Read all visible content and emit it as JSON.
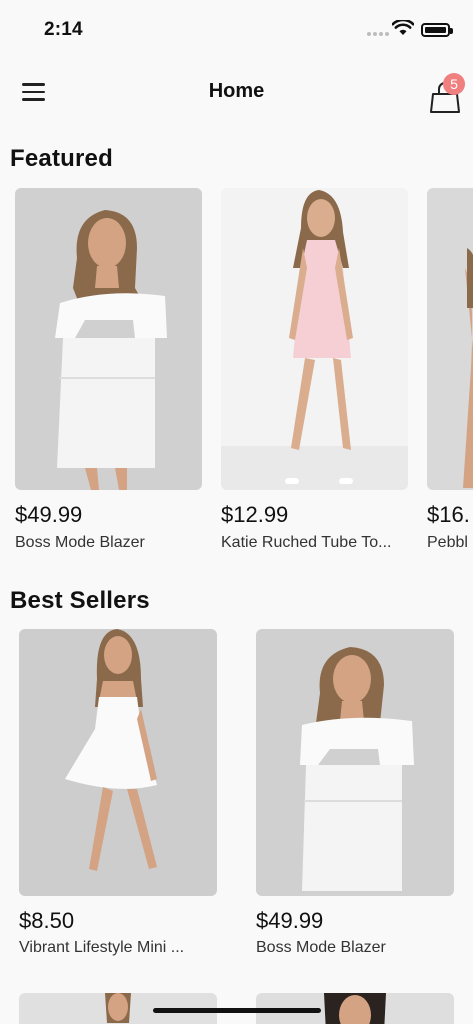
{
  "status": {
    "time": "2:14"
  },
  "nav": {
    "title": "Home",
    "cart_count": "5"
  },
  "featured": {
    "title": "Featured",
    "items": [
      {
        "price": "$49.99",
        "name": "Boss Mode Blazer"
      },
      {
        "price": "$12.99",
        "name": "Katie Ruched Tube To..."
      },
      {
        "price": "$16.",
        "name": "Pebbl"
      }
    ]
  },
  "best_sellers": {
    "title": "Best Sellers",
    "items": [
      {
        "price": "$8.50",
        "name": "Vibrant Lifestyle Mini ..."
      },
      {
        "price": "$49.99",
        "name": "Boss Mode Blazer"
      }
    ]
  },
  "colors": {
    "badge": "#f08080",
    "background": "#f9f9f9"
  }
}
